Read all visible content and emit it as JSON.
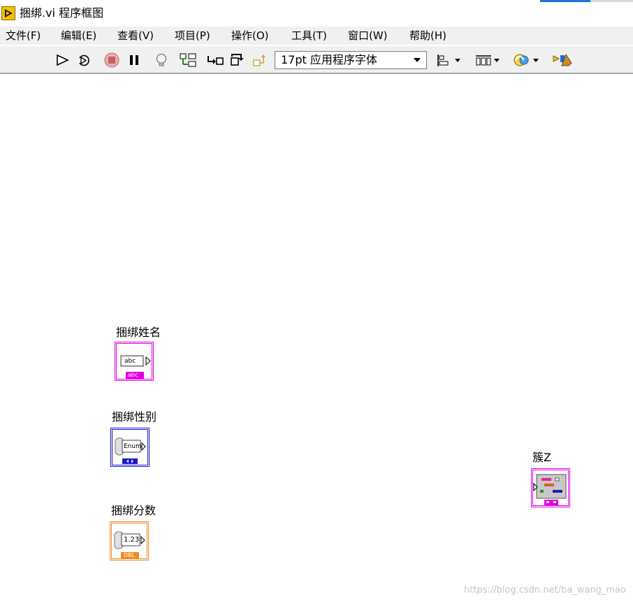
{
  "window": {
    "title": "捆绑.vi 程序框图"
  },
  "menu": {
    "items": [
      {
        "label": "文件(F)"
      },
      {
        "label": "编辑(E)"
      },
      {
        "label": "查看(V)"
      },
      {
        "label": "项目(P)"
      },
      {
        "label": "操作(O)"
      },
      {
        "label": "工具(T)"
      },
      {
        "label": "窗口(W)"
      },
      {
        "label": "帮助(H)"
      }
    ]
  },
  "toolbar": {
    "font_select": {
      "value": "17pt 应用程序字体"
    },
    "icons": [
      "run-arrow-icon",
      "run-continuously-icon",
      "abort-icon",
      "pause-icon",
      "highlight-execution-icon",
      "retain-wire-values-icon",
      "step-into-icon",
      "step-over-icon",
      "step-out-icon",
      "align-objects-icon",
      "distribute-objects-icon",
      "reorder-icon",
      "clean-up-diagram-icon"
    ]
  },
  "diagram": {
    "terminals": [
      {
        "label": "捆绑姓名",
        "inner": "abc",
        "type_tag": "abc",
        "color": "#e000e0"
      },
      {
        "label": "捆绑性别",
        "inner": "Enum",
        "type_tag": "",
        "color": "#1a1acc"
      },
      {
        "label": "捆绑分数",
        "inner": "1.23",
        "type_tag": "DBL",
        "color": "#f08a1e"
      },
      {
        "label": "簇Z",
        "inner": "",
        "type_tag": "",
        "color": "#e000e0"
      }
    ]
  },
  "watermark": "https://blog.csdn.net/ba_wang_mao"
}
